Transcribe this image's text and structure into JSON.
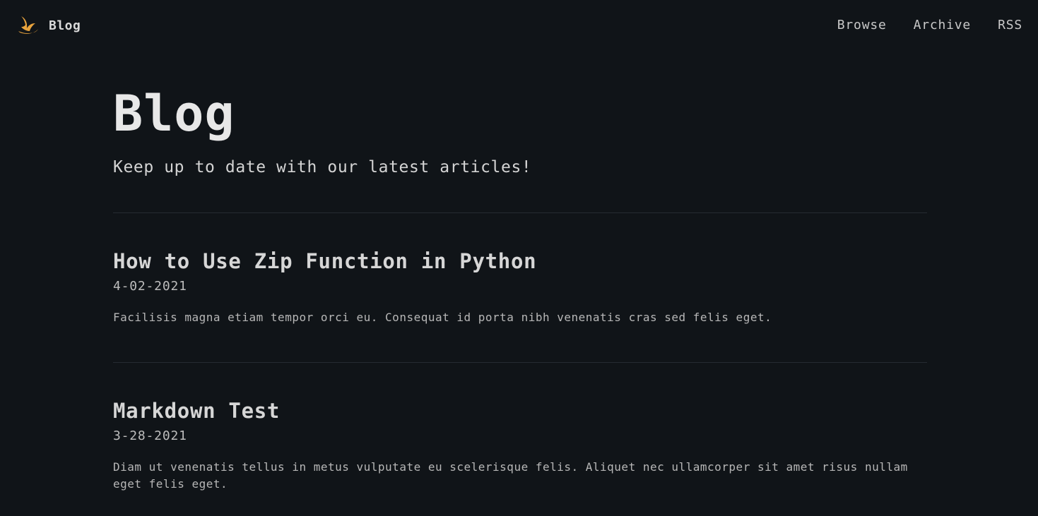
{
  "header": {
    "brand_name": "Blog",
    "brand_icon": "bird-logo-icon",
    "nav": [
      {
        "label": "Browse"
      },
      {
        "label": "Archive"
      },
      {
        "label": "RSS"
      }
    ]
  },
  "page": {
    "title": "Blog",
    "subtitle": "Keep up to date with our latest articles!"
  },
  "posts": [
    {
      "title": "How to Use Zip Function in Python",
      "date": "4-02-2021",
      "excerpt": "Facilisis magna etiam tempor orci eu. Consequat id porta nibh venenatis cras sed felis eget."
    },
    {
      "title": "Markdown Test",
      "date": "3-28-2021",
      "excerpt": "Diam ut venenatis tellus in metus vulputate eu scelerisque felis. Aliquet nec ullamcorper sit amet risus nullam eget felis eget."
    }
  ],
  "colors": {
    "background": "#101418",
    "accent": "#e8a33d",
    "divider": "#262b31"
  }
}
